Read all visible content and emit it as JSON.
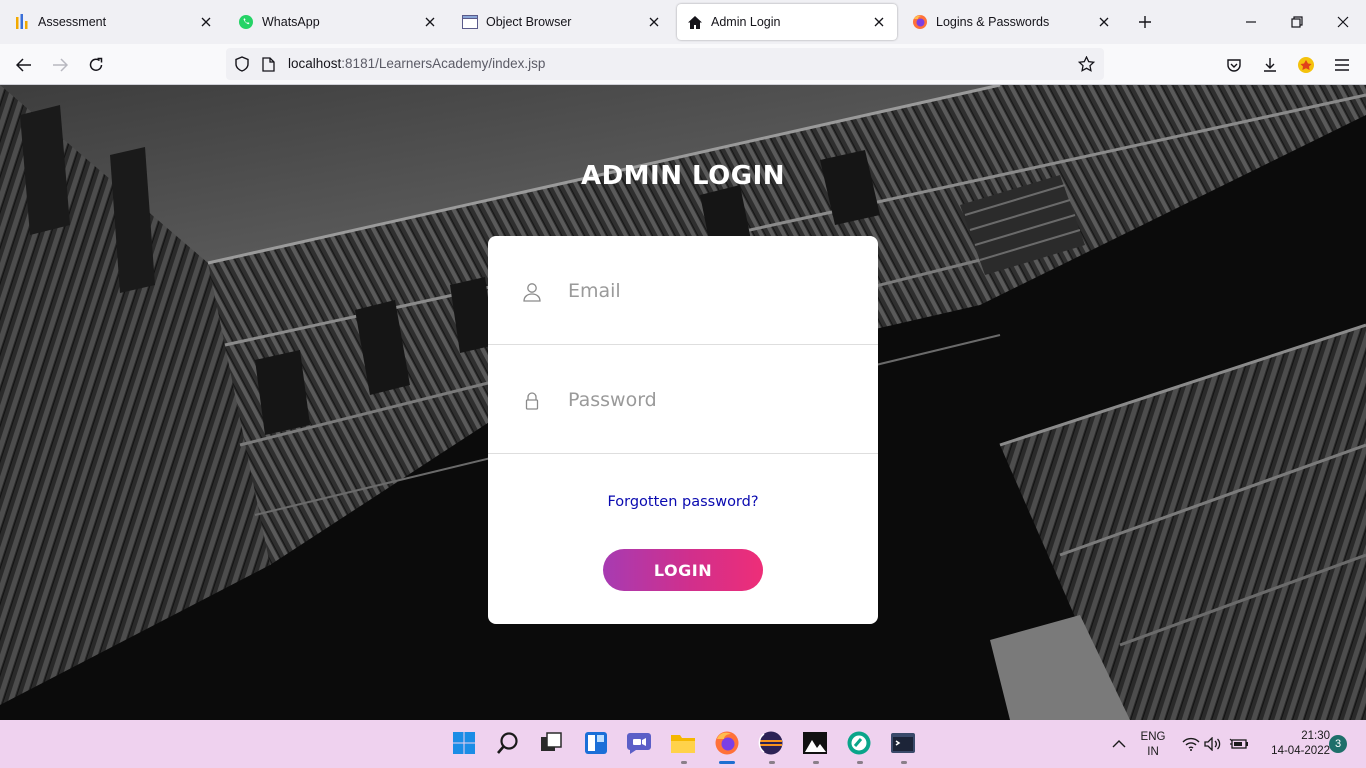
{
  "browser": {
    "tabs": [
      {
        "label": "Assessment",
        "icon": "bar-chart-icon",
        "active": false
      },
      {
        "label": "WhatsApp",
        "icon": "whatsapp-icon",
        "active": false
      },
      {
        "label": "Object Browser",
        "icon": "window-icon",
        "active": false
      },
      {
        "label": "Admin Login",
        "icon": "home-icon",
        "active": true
      },
      {
        "label": "Logins & Passwords",
        "icon": "firefox-icon",
        "active": false
      }
    ],
    "url": {
      "host": "localhost",
      "path": ":8181/LearnersAcademy/index.jsp"
    }
  },
  "page": {
    "heading": "ADMIN LOGIN",
    "email_placeholder": "Email",
    "password_placeholder": "Password",
    "forgot_link": "Forgotten password?",
    "login_button": "LOGIN"
  },
  "taskbar": {
    "apps": [
      "windows-start-icon",
      "search-icon",
      "task-view-icon",
      "widgets-icon",
      "chat-icon",
      "file-explorer-icon",
      "firefox-icon",
      "eclipse-icon",
      "photos-icon",
      "app-icon",
      "terminal-icon"
    ],
    "language": "ENG",
    "region": "IN",
    "time": "21:30",
    "date": "14-04-2022",
    "notifications": "3"
  },
  "colors": {
    "login_gradient_start": "#a73bb2",
    "login_gradient_end": "#ee2e78",
    "link": "#0a0ab0",
    "taskbar_bg": "#efd2ef"
  }
}
